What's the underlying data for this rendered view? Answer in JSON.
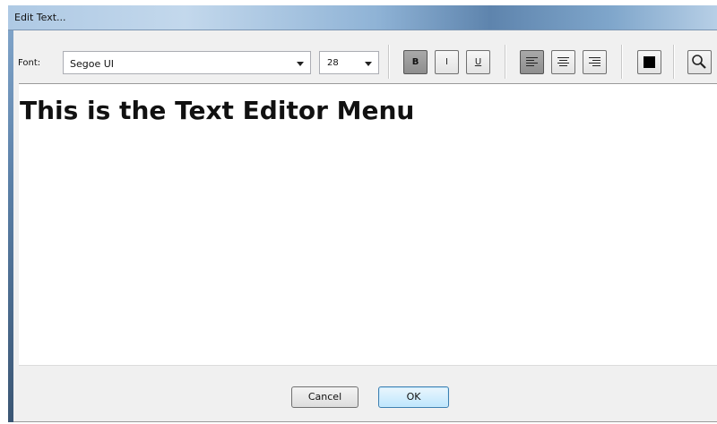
{
  "window": {
    "title": "Edit Text..."
  },
  "toolbar": {
    "font_label": "Font:",
    "font_value": "Segoe UI",
    "size_value": "28",
    "bold_label": "B",
    "italic_label": "I",
    "underline_label": "U",
    "bold_pressed": true,
    "align_left_pressed": true,
    "text_color": "#000000"
  },
  "editor": {
    "text": "This is the Text Editor Menu"
  },
  "footer": {
    "cancel_label": "Cancel",
    "ok_label": "OK"
  }
}
